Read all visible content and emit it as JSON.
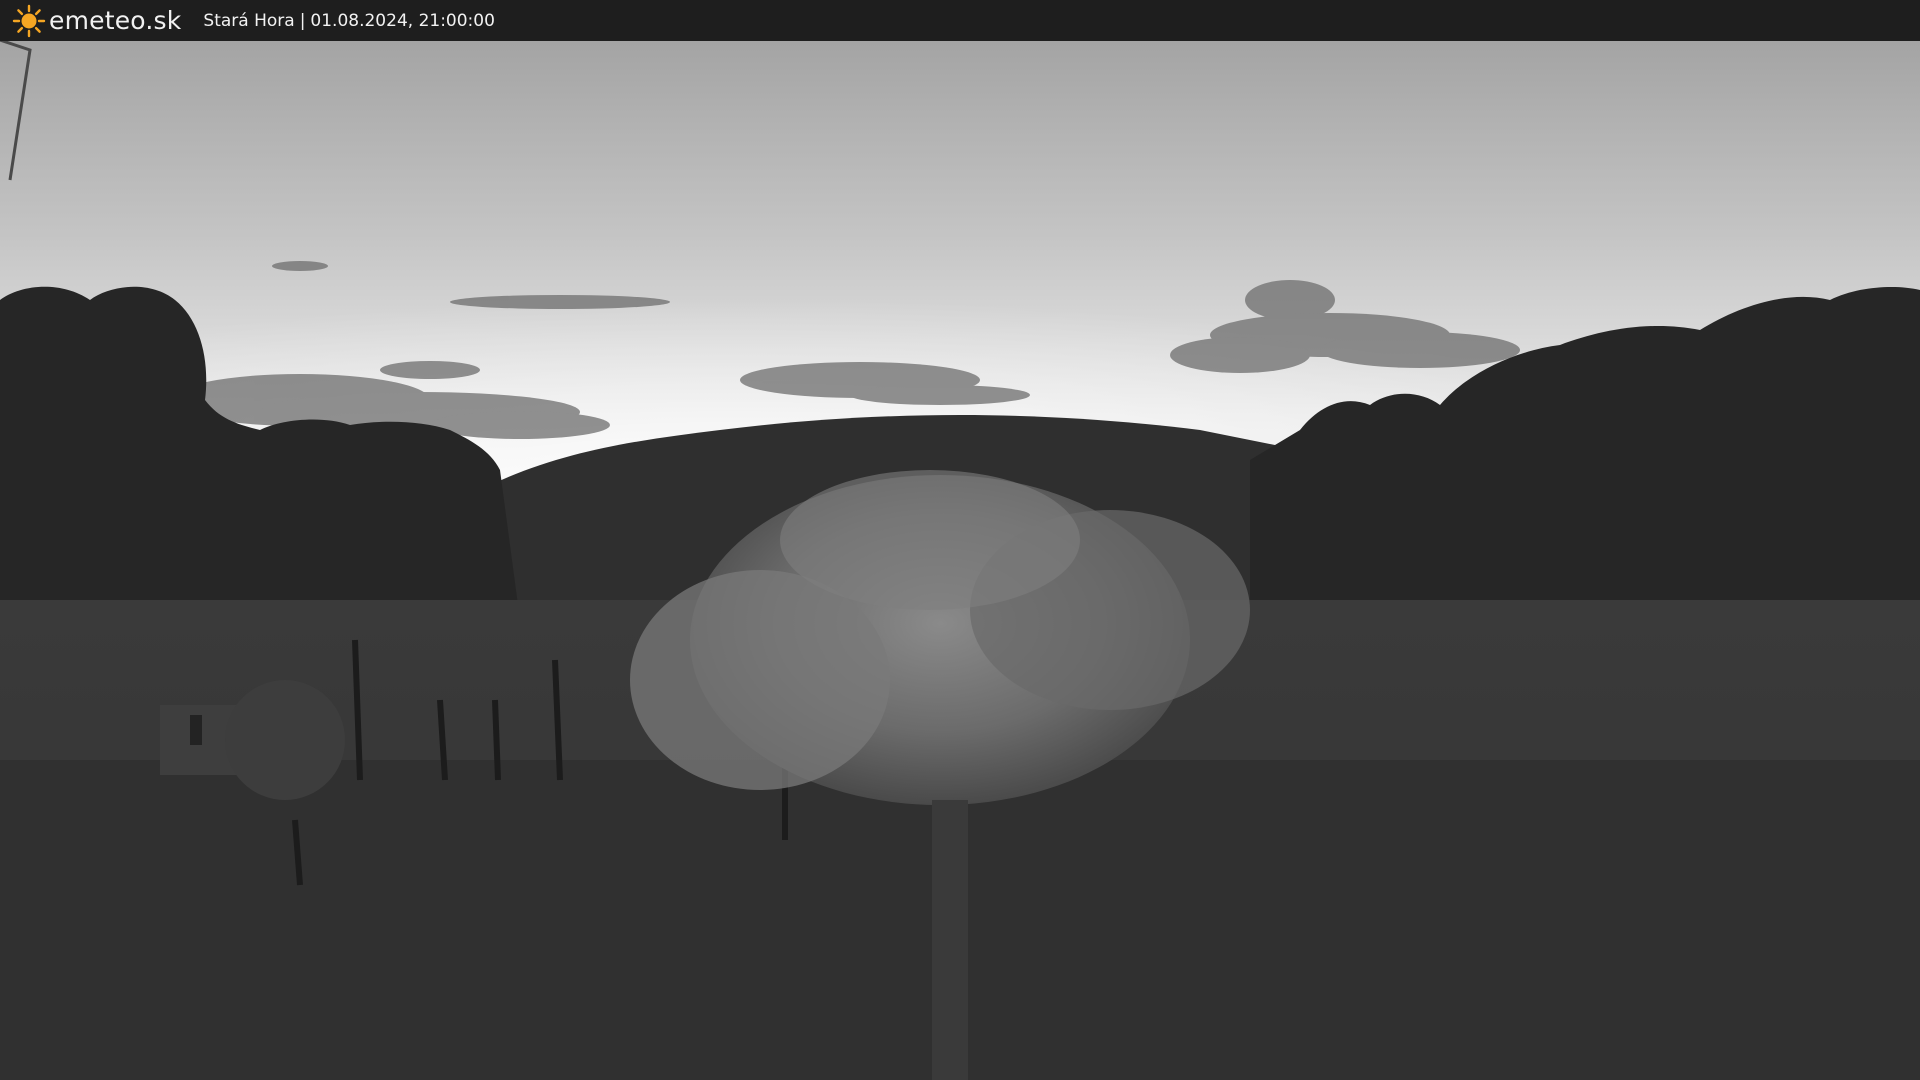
{
  "header": {
    "brand": "emeteo.sk",
    "location": "Stará Hora",
    "separator": "|",
    "datetime": "01.08.2024, 21:00:00"
  },
  "icons": {
    "logo": "sun-icon"
  },
  "colors": {
    "header_bg": "#1e1e1e",
    "header_text": "#f2f2f2",
    "sun_accent": "#f5a623"
  }
}
